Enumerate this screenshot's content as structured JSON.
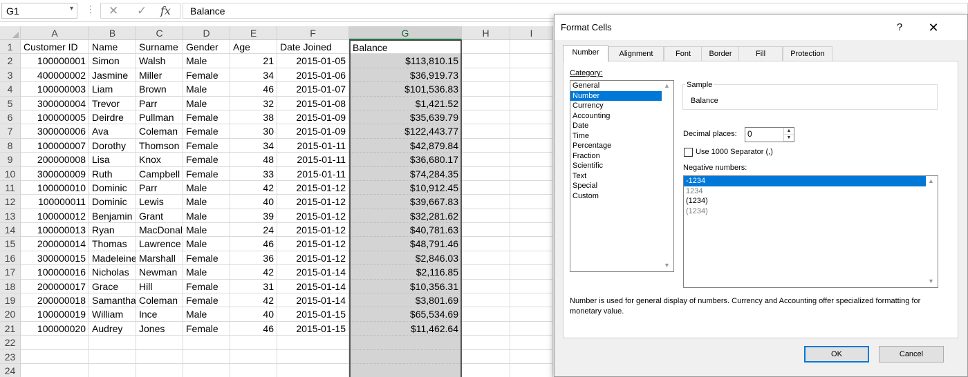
{
  "formula_bar": {
    "name_box": "G1",
    "fx_label": "fx",
    "formula": "Balance"
  },
  "sheet": {
    "columns": [
      "A",
      "B",
      "C",
      "D",
      "E",
      "F",
      "G",
      "H",
      "I"
    ],
    "selected_column": "G",
    "rows": [
      [
        "Customer ID",
        "Name",
        "Surname",
        "Gender",
        "Age",
        "Date Joined",
        "Balance"
      ],
      [
        "100000001",
        "Simon",
        "Walsh",
        "Male",
        "21",
        "2015-01-05",
        "$113,810.15"
      ],
      [
        "400000002",
        "Jasmine",
        "Miller",
        "Female",
        "34",
        "2015-01-06",
        "$36,919.73"
      ],
      [
        "100000003",
        "Liam",
        "Brown",
        "Male",
        "46",
        "2015-01-07",
        "$101,536.83"
      ],
      [
        "300000004",
        "Trevor",
        "Parr",
        "Male",
        "32",
        "2015-01-08",
        "$1,421.52"
      ],
      [
        "100000005",
        "Deirdre",
        "Pullman",
        "Female",
        "38",
        "2015-01-09",
        "$35,639.79"
      ],
      [
        "300000006",
        "Ava",
        "Coleman",
        "Female",
        "30",
        "2015-01-09",
        "$122,443.77"
      ],
      [
        "100000007",
        "Dorothy",
        "Thomson",
        "Female",
        "34",
        "2015-01-11",
        "$42,879.84"
      ],
      [
        "200000008",
        "Lisa",
        "Knox",
        "Female",
        "48",
        "2015-01-11",
        "$36,680.17"
      ],
      [
        "300000009",
        "Ruth",
        "Campbell",
        "Female",
        "33",
        "2015-01-11",
        "$74,284.35"
      ],
      [
        "100000010",
        "Dominic",
        "Parr",
        "Male",
        "42",
        "2015-01-12",
        "$10,912.45"
      ],
      [
        "100000011",
        "Dominic",
        "Lewis",
        "Male",
        "40",
        "2015-01-12",
        "$39,667.83"
      ],
      [
        "100000012",
        "Benjamin",
        "Grant",
        "Male",
        "39",
        "2015-01-12",
        "$32,281.62"
      ],
      [
        "100000013",
        "Ryan",
        "MacDonal",
        "Male",
        "24",
        "2015-01-12",
        "$40,781.63"
      ],
      [
        "200000014",
        "Thomas",
        "Lawrence",
        "Male",
        "46",
        "2015-01-12",
        "$48,791.46"
      ],
      [
        "300000015",
        "Madeleine",
        "Marshall",
        "Female",
        "36",
        "2015-01-12",
        "$2,846.03"
      ],
      [
        "100000016",
        "Nicholas",
        "Newman",
        "Male",
        "42",
        "2015-01-14",
        "$2,116.85"
      ],
      [
        "200000017",
        "Grace",
        "Hill",
        "Female",
        "31",
        "2015-01-14",
        "$10,356.31"
      ],
      [
        "200000018",
        "Samantha",
        "Coleman",
        "Female",
        "42",
        "2015-01-14",
        "$3,801.69"
      ],
      [
        "100000019",
        "William",
        "Ince",
        "Male",
        "40",
        "2015-01-15",
        "$65,534.69"
      ],
      [
        "100000020",
        "Audrey",
        "Jones",
        "Female",
        "46",
        "2015-01-15",
        "$11,462.64"
      ],
      [
        "",
        "",
        "",
        "",
        "",
        "",
        ""
      ],
      [
        "",
        "",
        "",
        "",
        "",
        "",
        ""
      ],
      [
        "",
        "",
        "",
        "",
        "",
        "",
        ""
      ]
    ]
  },
  "dialog": {
    "title": "Format Cells",
    "help": "?",
    "close": "✕",
    "tabs": [
      "Number",
      "Alignment",
      "Font",
      "Border",
      "Fill",
      "Protection"
    ],
    "active_tab": "Number",
    "category_label": "Category:",
    "categories": [
      "General",
      "Number",
      "Currency",
      "Accounting",
      "Date",
      "Time",
      "Percentage",
      "Fraction",
      "Scientific",
      "Text",
      "Special",
      "Custom"
    ],
    "selected_category": "Number",
    "sample_label": "Sample",
    "sample_value": "Balance",
    "decimal_label": "Decimal places:",
    "decimal_value": "0",
    "separator_label": "Use 1000 Separator (,)",
    "separator_checked": false,
    "negative_label": "Negative numbers:",
    "negative_options": [
      "-1234",
      "1234",
      "(1234)",
      "(1234)"
    ],
    "selected_negative": "-1234",
    "description": "Number is used for general display of numbers.  Currency and Accounting offer specialized formatting for monetary value.",
    "ok": "OK",
    "cancel": "Cancel"
  }
}
